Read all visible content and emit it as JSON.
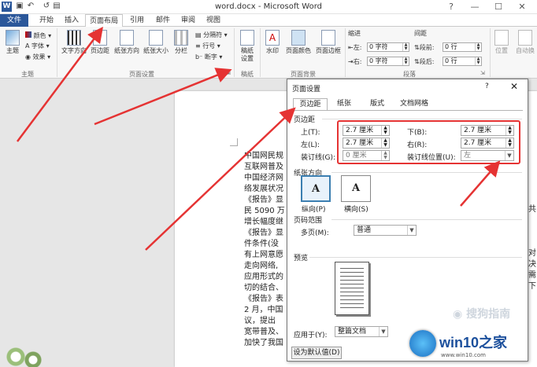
{
  "window": {
    "title": "word.docx - Microsoft Word",
    "app_letter": "W",
    "controls": [
      "?",
      "—",
      "☐",
      "✕"
    ]
  },
  "tabs": [
    "文件",
    "开始",
    "插入",
    "页面布局",
    "引用",
    "邮件",
    "审阅",
    "视图"
  ],
  "ribbon": {
    "theme": {
      "label": "主题",
      "colors": "颜色",
      "fonts": "字体",
      "effects": "效果",
      "group": "主题"
    },
    "page_setup": {
      "text_direction": "文字方向",
      "margins": "页边距",
      "orientation": "纸张方向",
      "size": "纸张大小",
      "columns": "分栏",
      "breaks": "分隔符",
      "line_numbers": "行号",
      "hyphenation": "断字",
      "group": "页面设置"
    },
    "draft": {
      "label": "稿纸设置",
      "group": "稿纸"
    },
    "page_background": {
      "watermark": "水印",
      "page_color": "页面颜色",
      "page_borders": "页面边框",
      "group": "页面背景"
    },
    "paragraph": {
      "indent": "缩进",
      "spacing": "间距",
      "left": "左:",
      "right": "右:",
      "before": "段前:",
      "after": "段后:",
      "indent_left": "0 字符",
      "indent_right": "0 字符",
      "space_before": "0 行",
      "space_after": "0 行",
      "group": "段落"
    },
    "arrange": {
      "position": "位置",
      "wrap": "自动换"
    }
  },
  "document": {
    "lines": [
      "中国网民规",
      "互联网普及",
      "中国经济网",
      "络发展状况",
      "《报告》显",
      "民 5090 万",
      "增长幅度继",
      "《报告》显",
      "件条件(没",
      "有上网意愿",
      "走向网络,",
      "应用形式的",
      "切的结合、",
      "《报告》表",
      "2 月，中国",
      "议，提出",
      "宽带普及、",
      "加快了我国"
    ],
    "right_edge": [
      "共",
      "对",
      "决",
      "需",
      "下"
    ]
  },
  "dialog": {
    "title": "页面设置",
    "help": "?",
    "close": "✕",
    "tabs": [
      "页边距",
      "纸张",
      "版式",
      "文档网格"
    ],
    "margins_section": "页边距",
    "top_label": "上(T):",
    "top_value": "2.7 厘米",
    "bottom_label": "下(B):",
    "bottom_value": "2.7 厘米",
    "left_label": "左(L):",
    "left_value": "2.7 厘米",
    "right_label": "右(R):",
    "right_value": "2.7 厘米",
    "gutter_label": "装订线(G):",
    "gutter_value": "0 厘米",
    "gutter_pos_label": "装订线位置(U):",
    "gutter_pos_value": "左",
    "orientation_section": "纸张方向",
    "portrait_label": "纵向(P)",
    "landscape_label": "横向(S)",
    "pages_section": "页码范围",
    "multiple_pages_label": "多页(M):",
    "multiple_pages_value": "普通",
    "preview_section": "预览",
    "apply_to_label": "应用于(Y):",
    "apply_to_value": "整篇文档",
    "default_button": "设为默认值(D)",
    "watermark_text": "搜狗指南"
  },
  "branding": {
    "logo_text": "win10之家",
    "url": "www.win10.com"
  },
  "colors": {
    "file_tab": "#2b579a",
    "annotation_red": "#e53333",
    "selected_orientation": "#3c7fb1"
  }
}
